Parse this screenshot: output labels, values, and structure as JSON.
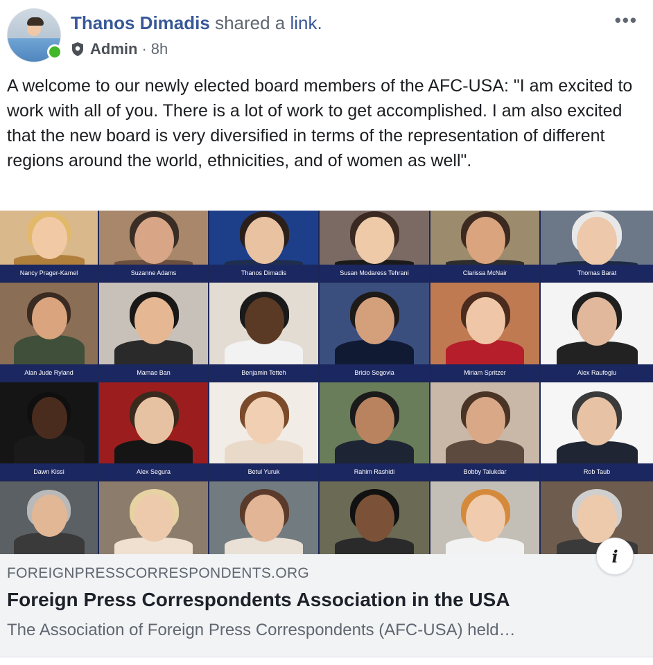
{
  "post": {
    "author": "Thanos Dimadis",
    "action": "shared a",
    "action_link": "link.",
    "role": "Admin",
    "separator": "·",
    "time": "8h",
    "more": "•••",
    "text": "A welcome to our newly elected board members of the AFC-USA: \"I am excited to work with all of you. There is a lot of work to get accomplished. I am also excited that the new board is very diversified in terms of the representation of different regions around the world, ethnicities, and of women as well\"."
  },
  "link": {
    "domain": "FOREIGNPRESSCORRESPONDENTS.ORG",
    "title": "Foreign Press Correspondents Association in the USA",
    "description": "The Association of Foreign Press Correspondents (AFC-USA) held…",
    "info_icon": "i"
  },
  "board_members": [
    [
      "Nancy Prager-Kamel",
      "Suzanne Adams",
      "Thanos Dimadis",
      "Susan Modaress Tehrani",
      "Clarissa McNair",
      "Thomas Barat"
    ],
    [
      "Alan Jude Ryland",
      "Mamae Ban",
      "Benjamin Tetteh",
      "Bricio Segovia",
      "Miriam Spritzer",
      "Alex Raufoglu"
    ],
    [
      "Dawn Kissi",
      "Alex Segura",
      "Betul Yuruk",
      "Rahim Rashidi",
      "Bobby Talukdar",
      "Rob Taub"
    ],
    [
      "",
      "",
      "",
      "",
      "",
      ""
    ]
  ],
  "colors": {
    "link_blue": "#385898",
    "online_green": "#42b72a",
    "name_bar": "#1b2760",
    "card_bg": "#f2f3f5"
  },
  "icons": {
    "more": "ellipsis-icon",
    "role": "shield-icon",
    "info": "info-icon"
  }
}
